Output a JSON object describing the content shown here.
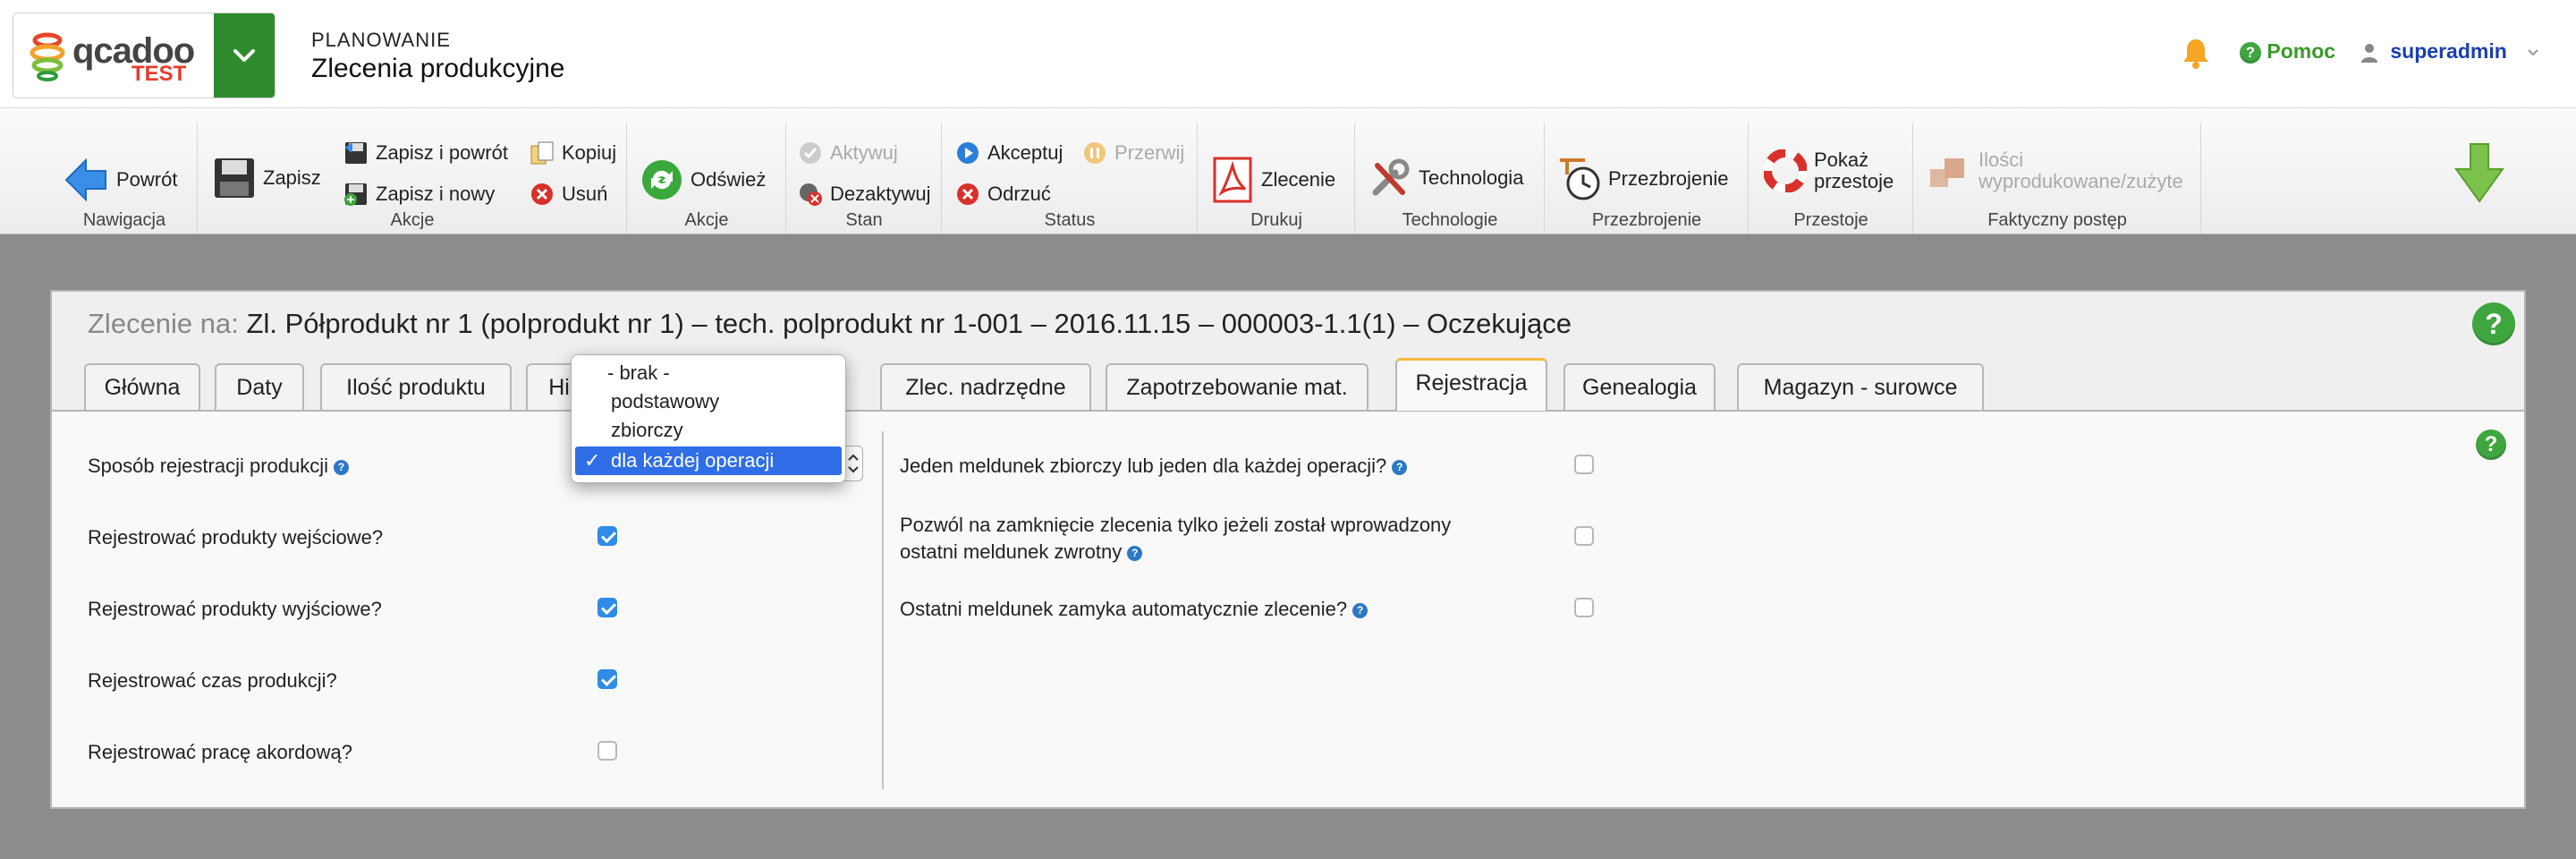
{
  "header": {
    "logo_text": "qcadoo",
    "logo_badge": "TEST",
    "module_label": "PLANOWANIE",
    "module_title": "Zlecenia produkcyjne",
    "help_label": "Pomoc",
    "user_label": "superadmin"
  },
  "ribbon": {
    "groups": {
      "nawigacja": "Nawigacja",
      "akcje1": "Akcje",
      "akcje2": "Akcje",
      "stan": "Stan",
      "status": "Status",
      "drukuj": "Drukuj",
      "technologie": "Technologie",
      "przezbrojenie": "Przezbrojenie",
      "przestoje": "Przestoje",
      "postep": "Faktyczny postęp"
    },
    "buttons": {
      "powrot": "Powrót",
      "zapisz": "Zapisz",
      "zapisz_powrot": "Zapisz i powrót",
      "zapisz_nowy": "Zapisz i nowy",
      "kopiuj": "Kopiuj",
      "usun": "Usuń",
      "odswiez": "Odśwież",
      "aktywuj": "Aktywuj",
      "dezaktywuj": "Dezaktywuj",
      "akceptuj": "Akceptuj",
      "przerwij": "Przerwij",
      "odrzuc": "Odrzuć",
      "zlecenie": "Zlecenie",
      "technologia": "Technologia",
      "przezbrojenie": "Przezbrojenie",
      "pokaz_przestoje_1": "Pokaż",
      "pokaz_przestoje_2": "przestoje",
      "ilosci_1": "Ilości",
      "ilosci_2": "wyprodukowane/zużyte"
    }
  },
  "form": {
    "title_prefix": "Zlecenie na:",
    "title": "Zl. Półprodukt nr 1 (polprodukt nr 1) – tech. polprodukt nr 1-001 – 2016.11.15 – 000003-1.1(1) – Oczekujące",
    "tabs": [
      "Główna",
      "Daty",
      "Ilość produktu",
      "Hi",
      "Zlec. nadrzędne",
      "Zapotrzebowanie mat.",
      "Rejestracja",
      "Genealogia",
      "Magazyn - surowce"
    ],
    "active_tab": "Rejestracja"
  },
  "left_fields": [
    {
      "label": "Sposób rejestracji produkcji",
      "help": true
    },
    {
      "label": "Rejestrować produkty wejściowe?",
      "checked": true
    },
    {
      "label": "Rejestrować produkty wyjściowe?",
      "checked": true
    },
    {
      "label": "Rejestrować czas produkcji?",
      "checked": true
    },
    {
      "label": "Rejestrować pracę akordową?",
      "checked": false
    }
  ],
  "right_fields": [
    {
      "label": "Jeden meldunek zbiorczy lub jeden dla każdej operacji?",
      "checked": false
    },
    {
      "label_line1": "Pozwól na zamknięcie zlecenia tylko jeżeli został wprowadzony",
      "label_line2": "ostatni meldunek zwrotny",
      "checked": false
    },
    {
      "label": "Ostatni meldunek zamyka automatycznie zlecenie?",
      "checked": false
    }
  ],
  "dropdown": {
    "options": [
      "- brak -",
      "podstawowy",
      "zbiorczy",
      "dla każdej operacji"
    ],
    "selected": "dla każdej operacji"
  }
}
